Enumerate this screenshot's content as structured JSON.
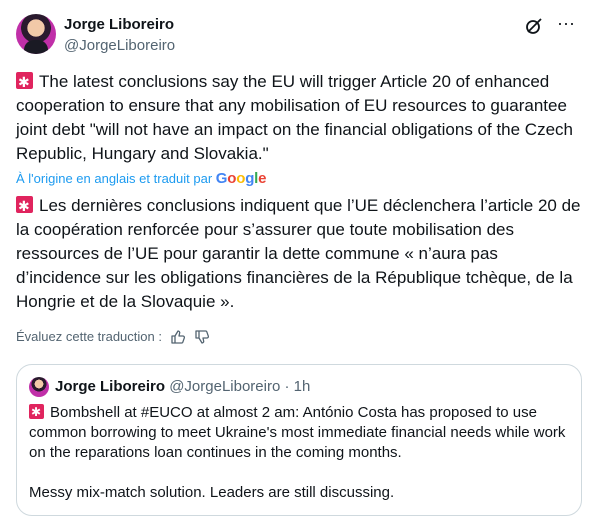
{
  "author": {
    "display_name": "Jorge Liboreiro",
    "handle": "@JorgeLiboreiro",
    "avatar_icon": "avatar-photo"
  },
  "header_icons": {
    "grok": "grok-icon",
    "more": "more-icon",
    "more_glyph": "···"
  },
  "emoji": {
    "name": "rotating-light-emoji",
    "color": "#e0245e"
  },
  "tweet": {
    "original_text": "The latest conclusions say the EU will trigger Article 20 of enhanced cooperation to ensure that any mobilisation of EU resources to guarantee joint debt \"will not have an impact on the financial obligations of the Czech Republic, Hungary and Slovakia.\"",
    "translation_note": "À l'origine en anglais et traduit par",
    "translation_provider": "Google",
    "translated_text": "Les dernières conclusions indiquent que l’UE déclenchera l’article 20 de la coopération renforcée pour s’assurer que toute mobilisation des ressources de l’UE pour garantir la dette commune « n’aura pas d’incidence sur les obligations financières de la République tchèque, de la Hongrie et de la Slovaquie ».",
    "rate_translation_label": "Évaluez cette traduction :"
  },
  "quoted_tweet": {
    "display_name": "Jorge Liboreiro",
    "handle": "@JorgeLiboreiro",
    "separator": "·",
    "time": "1h",
    "text_1": "Bombshell at #EUCO at almost 2 am: António Costa has proposed to use common borrowing to meet Ukraine's most immediate financial needs while work on the reparations loan continues in the coming months.",
    "text_2": "Messy mix-match solution. Leaders are still discussing."
  },
  "colors": {
    "text_primary": "#0f1419",
    "text_secondary": "#536471",
    "link_blue": "#1d9bf0",
    "border": "#cfd9de"
  }
}
